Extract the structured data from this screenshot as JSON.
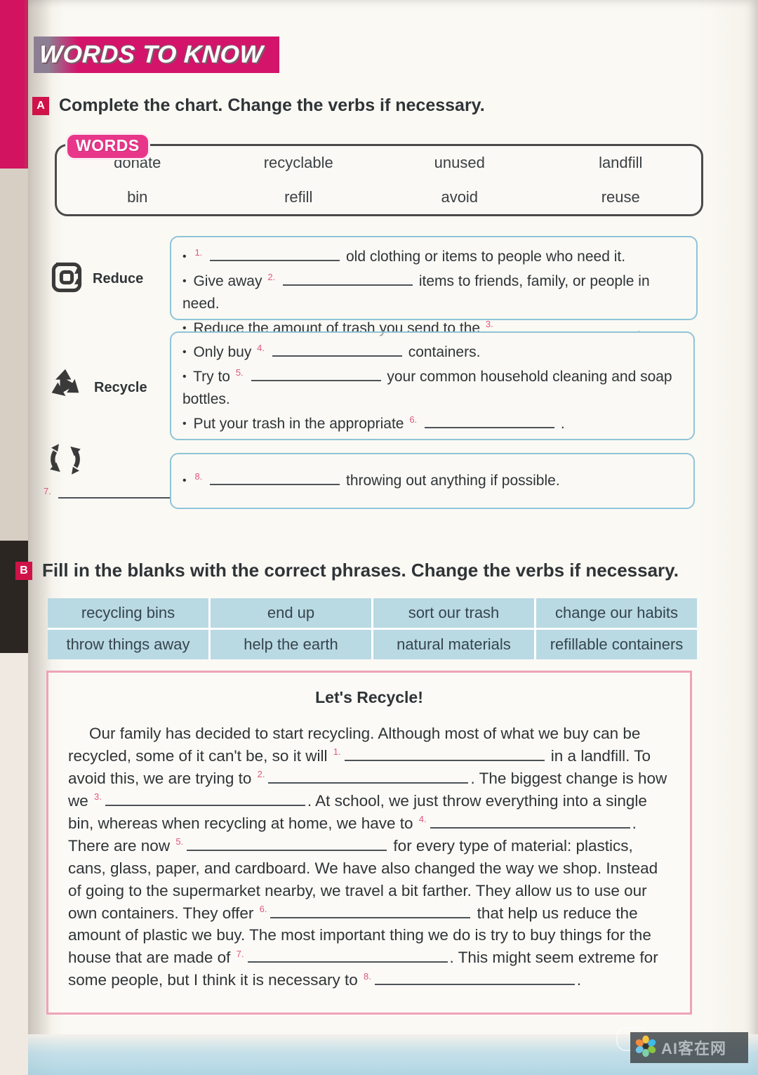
{
  "header": {
    "banner_title": "WORDS TO KNOW"
  },
  "section_a": {
    "marker": "A",
    "instruction": "Complete the chart. Change the verbs if necessary.",
    "word_bank": {
      "badge": "WORDS",
      "words": [
        "donate",
        "recyclable",
        "unused",
        "landfill",
        "bin",
        "refill",
        "avoid",
        "reuse"
      ]
    },
    "rows": [
      {
        "icon": "reduce-icon",
        "label": "Reduce",
        "items": [
          {
            "num": "1.",
            "pre": "",
            "post": "old clothing or items to people who need it.",
            "blank": "b-md",
            "blank_first": true
          },
          {
            "num": "2.",
            "pre": "Give away",
            "post": "items to friends, family, or people in need.",
            "blank": "b-md",
            "blank_first": false
          },
          {
            "num": "3.",
            "pre": "Reduce the amount of trash you send to the",
            "post": ".",
            "blank": "b-md",
            "blank_first": false
          }
        ]
      },
      {
        "icon": "recycle-icon",
        "label": "Recycle",
        "items": [
          {
            "num": "4.",
            "pre": "Only buy",
            "post": "containers.",
            "blank": "b-md",
            "blank_first": false
          },
          {
            "num": "5.",
            "pre": "Try to",
            "post": "your common household cleaning and soap bottles.",
            "blank": "b-md",
            "blank_first": false
          },
          {
            "num": "6.",
            "pre": "Put your trash in the appropriate",
            "post": ".",
            "blank": "b-md",
            "blank_first": false
          }
        ]
      },
      {
        "icon": "reuse-arrows-icon",
        "label_blank_num": "7.",
        "label": "",
        "items": [
          {
            "num": "8.",
            "pre": "",
            "post": "throwing out anything if possible.",
            "blank": "b-md",
            "blank_first": true
          }
        ]
      }
    ]
  },
  "section_b": {
    "marker": "B",
    "instruction": "Fill in the blanks with the correct phrases. Change the verbs if necessary.",
    "phrase_bank": [
      "recycling bins",
      "end up",
      "sort our trash",
      "change our habits",
      "throw things away",
      "help the earth",
      "natural materials",
      "refillable containers"
    ],
    "passage": {
      "title": "Let's Recycle!",
      "segments": [
        {
          "type": "indent"
        },
        {
          "type": "text",
          "value": "Our family has decided to start recycling. Although most of what we buy can be recycled, some of it can't be, so it will "
        },
        {
          "type": "blank",
          "num": "1.",
          "size": "b-xl"
        },
        {
          "type": "text",
          "value": " in a landfill. To avoid this, we are trying to "
        },
        {
          "type": "blank",
          "num": "2.",
          "size": "b-xl"
        },
        {
          "type": "text",
          "value": ". The biggest change is how we "
        },
        {
          "type": "blank",
          "num": "3.",
          "size": "b-xl"
        },
        {
          "type": "text",
          "value": ". At school, we just throw everything into a single bin, whereas when recycling at home, we have to "
        },
        {
          "type": "blank",
          "num": "4.",
          "size": "b-xl"
        },
        {
          "type": "text",
          "value": ". There are now "
        },
        {
          "type": "blank",
          "num": "5.",
          "size": "b-xl"
        },
        {
          "type": "text",
          "value": " for every type of material: plastics, cans, glass, paper, and cardboard. We have also changed the way we shop. Instead of going to the supermarket nearby, we travel a bit farther. They allow us to use our own containers. They offer "
        },
        {
          "type": "blank",
          "num": "6.",
          "size": "b-xl"
        },
        {
          "type": "text",
          "value": " that help us reduce the amount of plastic we buy. The most important thing we do is try to buy things for the house that are made of "
        },
        {
          "type": "blank",
          "num": "7.",
          "size": "b-xl"
        },
        {
          "type": "text",
          "value": ". This might seem extreme for some people, but I think it is necessary to "
        },
        {
          "type": "blank",
          "num": "8.",
          "size": "b-xl"
        },
        {
          "type": "text",
          "value": "."
        }
      ]
    }
  },
  "watermark": {
    "text": "AI客在网",
    "logo": "flower-logo-icon"
  },
  "colors": {
    "brand_pink": "#d4146b",
    "marker_red": "#cf1349",
    "badge_pink": "#e8368a",
    "answer_border_blue": "#8fc4d6",
    "phrase_cell_blue": "#b9d9e3",
    "passage_border_pink": "#eda4b8",
    "ink": "#2f3437"
  }
}
